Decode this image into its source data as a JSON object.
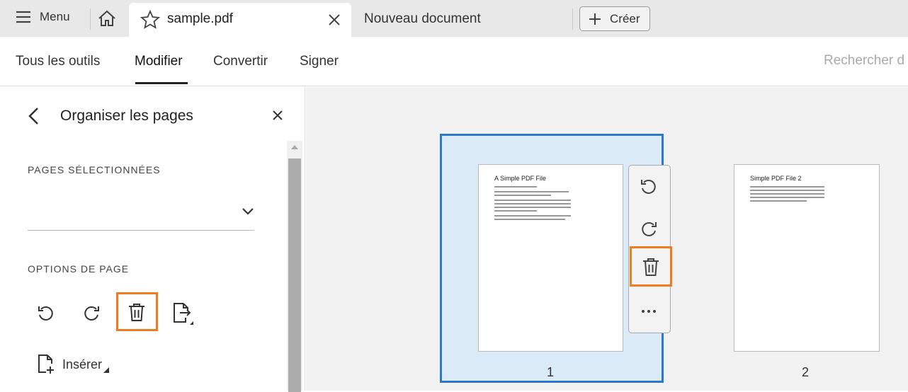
{
  "tabbar": {
    "menu_label": "Menu",
    "active_tab": "sample.pdf",
    "second_tab": "Nouveau document",
    "create_label": "Créer"
  },
  "toolbar": {
    "tools": [
      "Tous les outils",
      "Modifier",
      "Convertir",
      "Signer"
    ],
    "active": "Modifier",
    "search_placeholder": "Rechercher d"
  },
  "panel": {
    "title": "Organiser les pages",
    "selected_label": "PAGES SÉLECTIONNÉES",
    "options_label": "OPTIONS DE PAGE",
    "insert_label": "Insérer"
  },
  "pages": [
    {
      "number": "1",
      "heading": "A Simple PDF File",
      "selected": true
    },
    {
      "number": "2",
      "heading": "Simple PDF File 2",
      "selected": false
    }
  ],
  "colors": {
    "highlight": "#f07c22",
    "selection": "#2d79c7"
  }
}
